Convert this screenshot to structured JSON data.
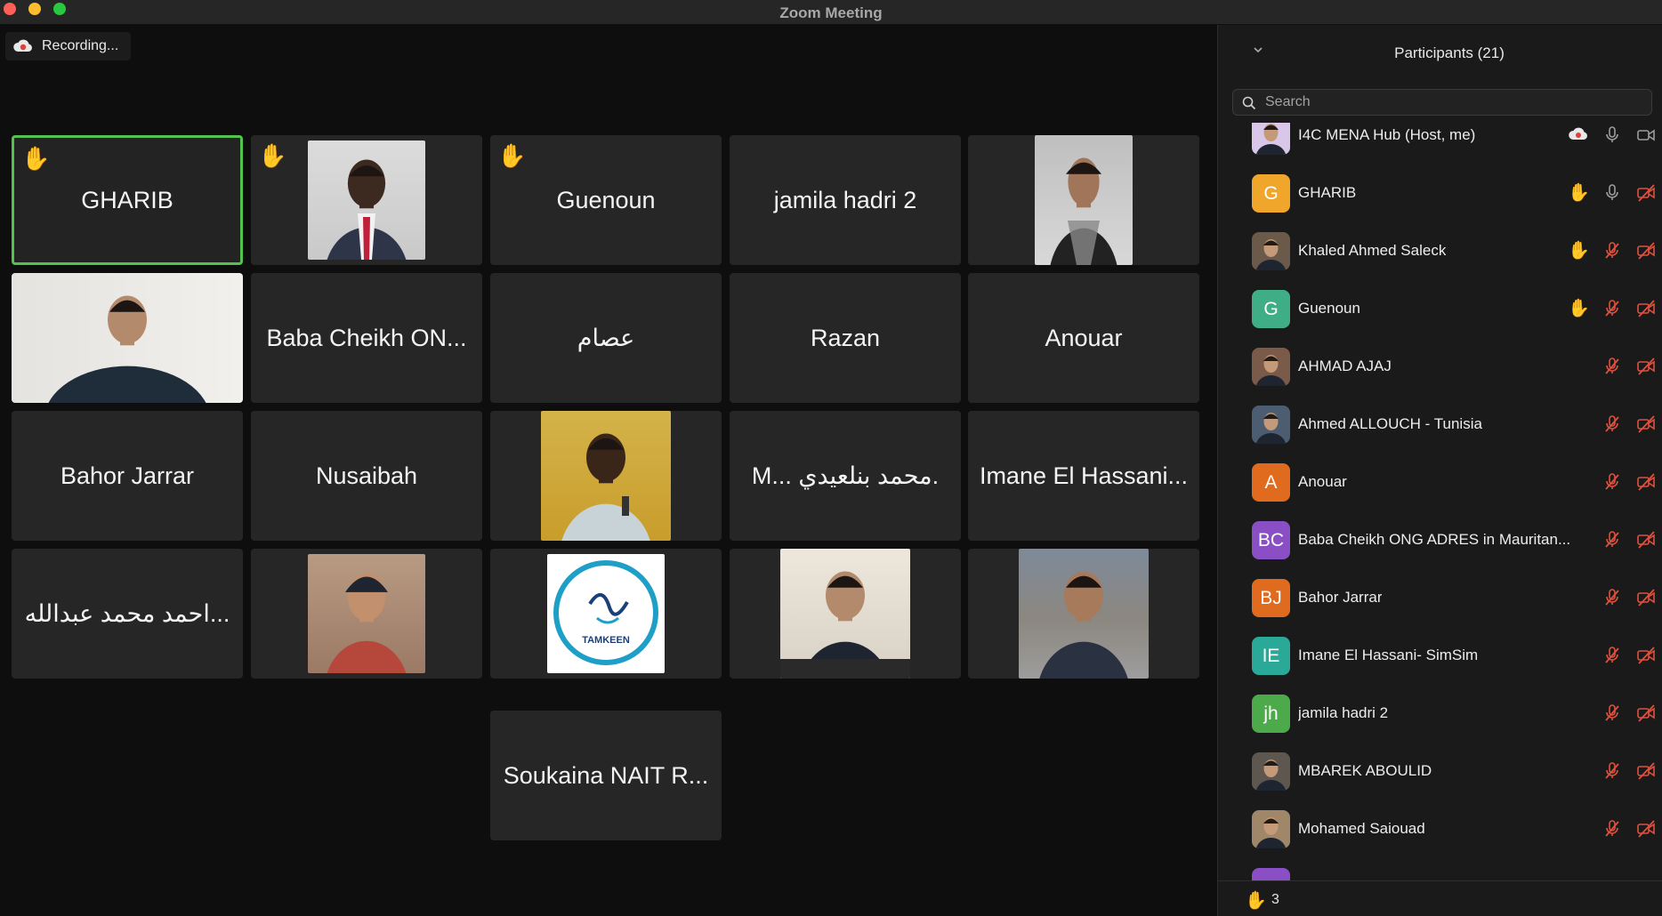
{
  "window": {
    "title": "Zoom Meeting"
  },
  "recording": {
    "label": "Recording..."
  },
  "tiles": [
    {
      "name": "GHARIB",
      "hand": true
    },
    {
      "name": "",
      "hand": true,
      "photo": "suit-red-tie"
    },
    {
      "name": "Guenoun",
      "hand": true
    },
    {
      "name": "jamila hadri 2",
      "hand": false
    },
    {
      "name": "",
      "hand": false,
      "photo": "man-scarf"
    },
    {
      "name": "",
      "hand": false,
      "photo": "man-white-wall"
    },
    {
      "name": "Baba Cheikh ON...",
      "hand": false
    },
    {
      "name": "عصام",
      "hand": false
    },
    {
      "name": "Razan",
      "hand": false
    },
    {
      "name": "Anouar",
      "hand": false
    },
    {
      "name": "Bahor Jarrar",
      "hand": false
    },
    {
      "name": "Nusaibah",
      "hand": false
    },
    {
      "name": "",
      "hand": false,
      "photo": "man-speaking-mic"
    },
    {
      "name": "M...  محمد بنلعيدي.",
      "hand": false
    },
    {
      "name": "Imane El Hassani...",
      "hand": false
    },
    {
      "name": "احمد محمد عبدالله...",
      "hand": false
    },
    {
      "name": "",
      "hand": false,
      "photo": "man-cap"
    },
    {
      "name": "",
      "hand": false,
      "photo": "tamkeen-logo",
      "logo_text": "TAMKEEN"
    },
    {
      "name": "",
      "hand": false,
      "photo": "man-at-desk"
    },
    {
      "name": "",
      "hand": false,
      "photo": "man-outdoor"
    },
    {
      "name": "Soukaina NAIT R...",
      "hand": false
    }
  ],
  "participants": {
    "title": "Participants (21)",
    "search_placeholder": "Search",
    "list": [
      {
        "name": "I4C MENA Hub (Host, me)",
        "initials": "",
        "color": "#d8c7e8",
        "hand": false,
        "muted": false,
        "video_off": false,
        "recording": true
      },
      {
        "name": "GHARIB",
        "initials": "G",
        "color": "#f0a52b",
        "hand": true,
        "muted": false,
        "video_off": true
      },
      {
        "name": "Khaled Ahmed Saleck",
        "initials": "",
        "color": "#6b5a4a",
        "hand": true,
        "muted": true,
        "video_off": true
      },
      {
        "name": "Guenoun",
        "initials": "G",
        "color": "#3fae86",
        "hand": true,
        "muted": true,
        "video_off": true
      },
      {
        "name": "AHMAD AJAJ",
        "initials": "",
        "color": "#7a5a48",
        "hand": false,
        "muted": true,
        "video_off": true
      },
      {
        "name": "Ahmed ALLOUCH - Tunisia",
        "initials": "",
        "color": "#4c5d72",
        "hand": false,
        "muted": true,
        "video_off": true
      },
      {
        "name": "Anouar",
        "initials": "A",
        "color": "#e06a1e",
        "hand": false,
        "muted": true,
        "video_off": true
      },
      {
        "name": "Baba Cheikh ONG ADRES in Mauritan...",
        "initials": "BC",
        "color": "#8a4fc4",
        "hand": false,
        "muted": true,
        "video_off": true
      },
      {
        "name": "Bahor Jarrar",
        "initials": "BJ",
        "color": "#e06a1e",
        "hand": false,
        "muted": true,
        "video_off": true
      },
      {
        "name": "Imane El Hassani- SimSim",
        "initials": "IE",
        "color": "#2aa898",
        "hand": false,
        "muted": true,
        "video_off": true
      },
      {
        "name": "jamila hadri 2",
        "initials": "jh",
        "color": "#4daa4b",
        "hand": false,
        "muted": true,
        "video_off": true
      },
      {
        "name": "MBAREK ABOULID",
        "initials": "",
        "color": "#5d5750",
        "hand": false,
        "muted": true,
        "video_off": true
      },
      {
        "name": "Mohamed Saiouad",
        "initials": "",
        "color": "#a0876a",
        "hand": false,
        "muted": true,
        "video_off": true
      },
      {
        "name": "",
        "initials": "",
        "color": "#8a4fc4",
        "hand": false,
        "muted": false,
        "video_off": false,
        "partial": true
      }
    ],
    "raised_hands_count": "3"
  },
  "colors": {
    "accent_green": "#53c34e",
    "muted_red": "#e0503c",
    "tile_bg": "#262626"
  }
}
